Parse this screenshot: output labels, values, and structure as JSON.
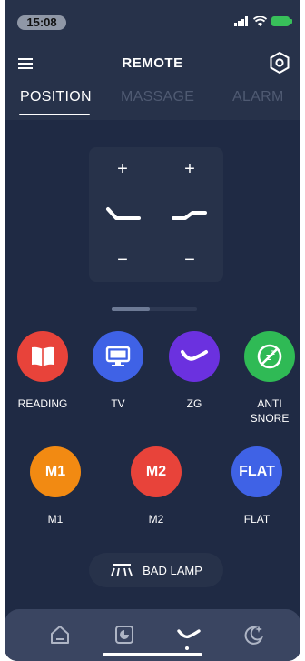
{
  "status_bar": {
    "time": "15:08"
  },
  "header": {
    "title": "REMOTE",
    "menu_icon": "hamburger-icon",
    "settings_icon": "settings-icon"
  },
  "tabs": [
    {
      "label": "POSITION",
      "active": true
    },
    {
      "label": "MASSAGE",
      "active": false
    },
    {
      "label": "ALARM",
      "active": false
    }
  ],
  "position_panel": {
    "head": {
      "up": "+",
      "down": "−",
      "icon": "head-incline-icon"
    },
    "foot": {
      "up": "+",
      "down": "−",
      "icon": "foot-incline-icon"
    }
  },
  "pager": {
    "page": 1,
    "pages": 2
  },
  "presets": [
    {
      "label": "READING",
      "icon": "book-icon",
      "color": "#e8433a"
    },
    {
      "label": "TV",
      "icon": "monitor-icon",
      "color": "#3f62e6"
    },
    {
      "label": "ZG",
      "icon": "zero-gravity-icon",
      "color": "#6b31df"
    },
    {
      "label": "ANTI SNORE",
      "icon": "no-snore-icon",
      "color": "#2fba55"
    }
  ],
  "memory": [
    {
      "label": "M1",
      "text": "M1",
      "color": "#f28a12"
    },
    {
      "label": "M2",
      "text": "M2",
      "color": "#e8433a"
    },
    {
      "label": "FLAT",
      "text": "FLAT",
      "color": "#3f62e6"
    }
  ],
  "lamp": {
    "label": "BAD LAMP",
    "icon": "lamp-icon"
  },
  "bottom_nav": [
    {
      "name": "home",
      "icon": "home-icon",
      "active": false
    },
    {
      "name": "timer",
      "icon": "timer-icon",
      "active": false
    },
    {
      "name": "remote",
      "icon": "bed-icon",
      "active": true
    },
    {
      "name": "sleep",
      "icon": "moon-icon",
      "active": false
    }
  ]
}
